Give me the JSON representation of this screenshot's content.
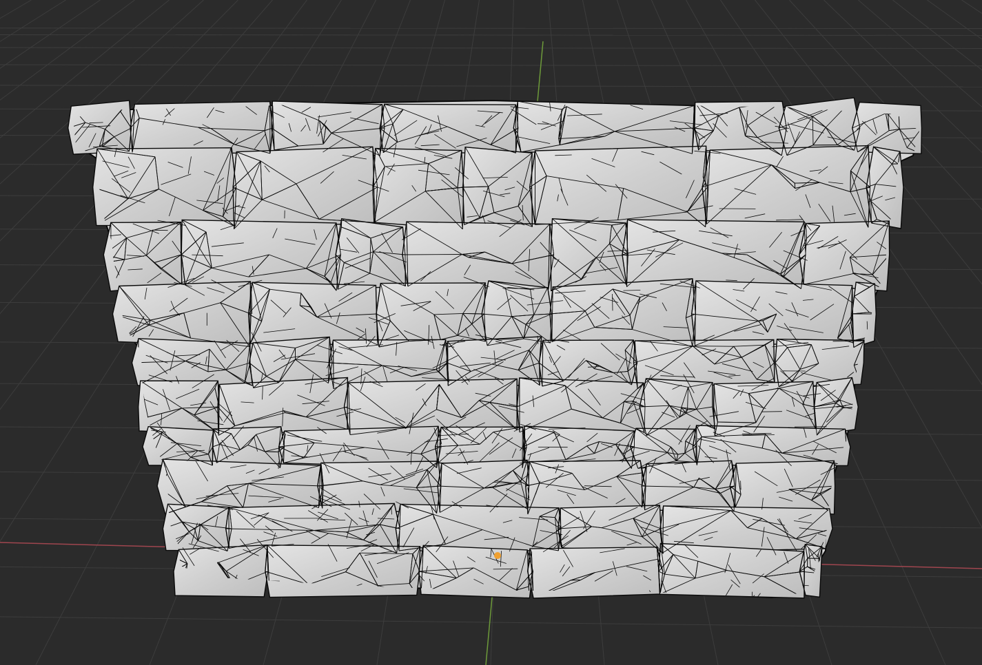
{
  "viewport": {
    "background_color": "#2b2b2b",
    "grid_color": "#3d3d3d",
    "x_axis_color": "#a0464f",
    "y_axis_color": "#6d9a3a",
    "origin_color": "#f0a030"
  },
  "object": {
    "shading_color": "#d6d6d6",
    "wire_color": "#0a0a0a",
    "selected": false
  }
}
